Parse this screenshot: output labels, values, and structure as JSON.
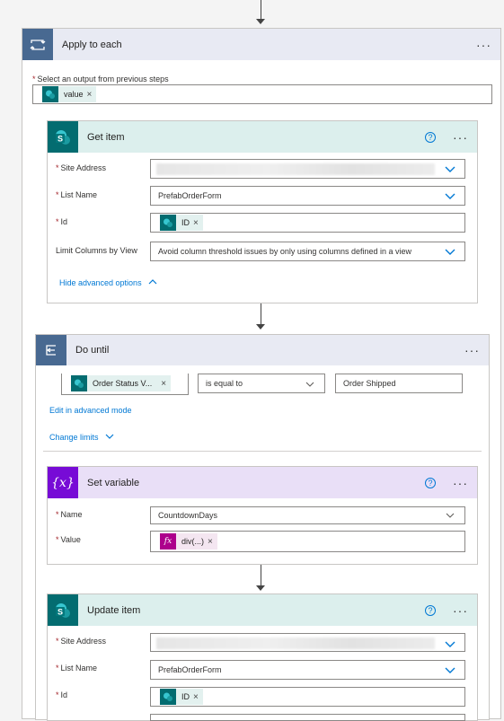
{
  "apply_each": {
    "title": "Apply to each",
    "select_label": "Select an output from previous steps",
    "token": "value",
    "menu": "···"
  },
  "get_item": {
    "title": "Get item",
    "help": "?",
    "menu": "···",
    "site_label": "Site Address",
    "list_label": "List Name",
    "list_value": "PrefabOrderForm",
    "id_label": "Id",
    "id_token": "ID",
    "limit_label": "Limit Columns by View",
    "limit_value": "Avoid column threshold issues by only using columns defined in a view",
    "advanced": "Hide advanced options"
  },
  "do_until": {
    "title": "Do until",
    "menu": "···",
    "cond_token": "Order Status V...",
    "operator": "is equal to",
    "compare_value": "Order Shipped",
    "edit_advanced": "Edit in advanced mode",
    "change_limits": "Change limits"
  },
  "set_variable": {
    "title": "Set variable",
    "help": "?",
    "menu": "···",
    "icon_text": "{x}",
    "name_label": "Name",
    "name_value": "CountdownDays",
    "value_label": "Value",
    "value_token": "div(...)",
    "fx": "fx"
  },
  "update_item": {
    "title": "Update item",
    "help": "?",
    "menu": "···",
    "site_label": "Site Address",
    "list_label": "List Name",
    "list_value": "PrefabOrderForm",
    "id_label": "Id",
    "id_token": "ID"
  },
  "colors": {
    "loop_header": "#e8eaf3",
    "loop_icon": "#486991",
    "sp_header": "#dcefed",
    "sp_icon": "#036c70",
    "var_header": "#e9dff7",
    "var_icon": "#770bd6",
    "fx_pink": "#ad008c",
    "link": "#0078d4"
  }
}
